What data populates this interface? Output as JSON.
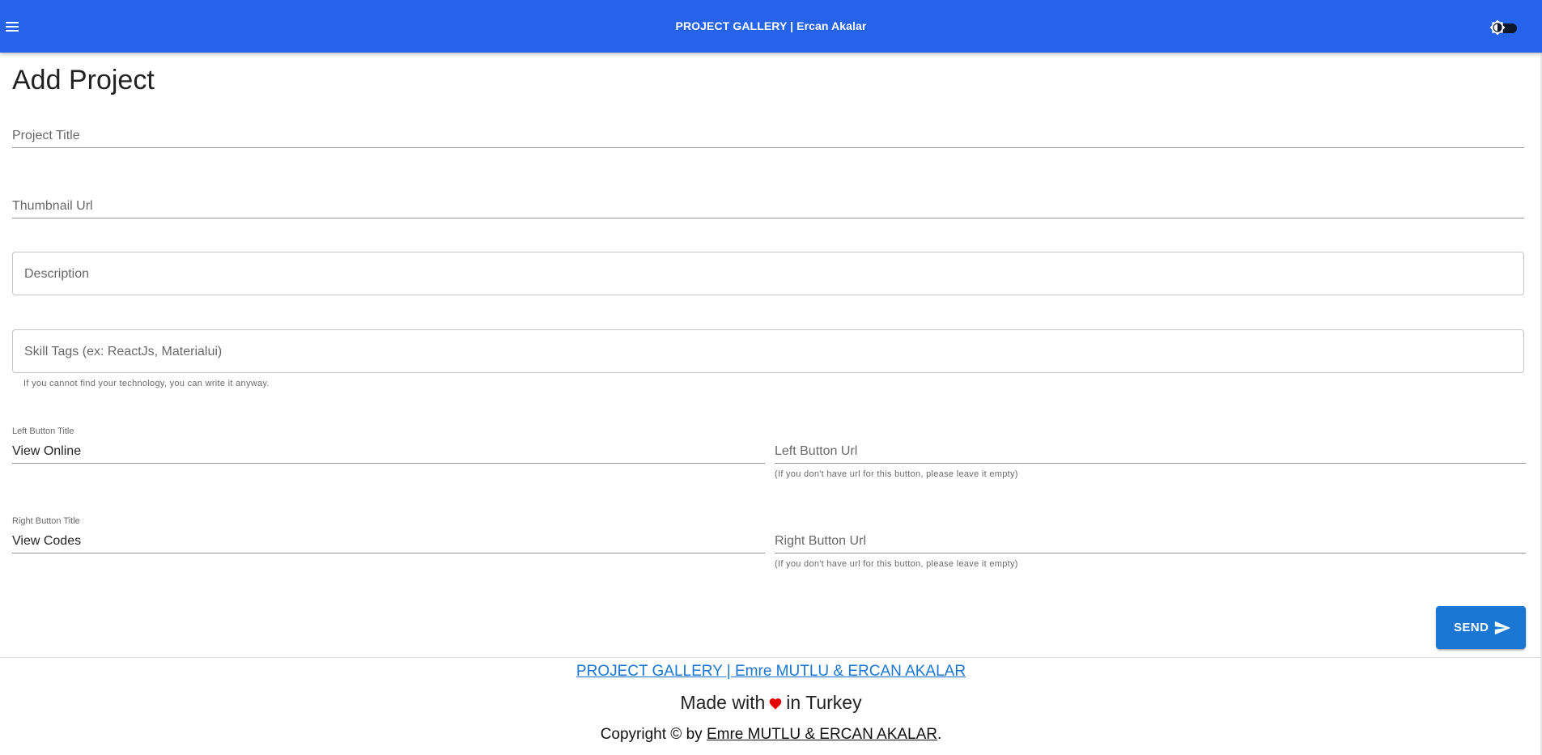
{
  "appbar": {
    "title": "PROJECT GALLERY  | Ercan Akalar",
    "menu_icon": "hamburger-menu-icon",
    "theme_icon": "brightness-icon",
    "color": "#2563eb"
  },
  "form": {
    "heading": "Add Project",
    "project_title": {
      "placeholder": "Project Title",
      "value": ""
    },
    "thumbnail_url": {
      "placeholder": "Thumbnail Url",
      "value": ""
    },
    "description": {
      "placeholder": "Description",
      "value": ""
    },
    "skill_tags": {
      "placeholder": "Skill Tags (ex: ReactJs, Materialui)",
      "helper": "If you cannot find your technology, you can write it anyway."
    },
    "left_button_title": {
      "label": "Left Button Title",
      "value": "View Online"
    },
    "left_button_url": {
      "placeholder": "Left Button Url",
      "helper": "(If you don't have url for this button, please leave it empty)"
    },
    "right_button_title": {
      "label": "Right Button Title",
      "value": "View Codes"
    },
    "right_button_url": {
      "placeholder": "Right Button Url",
      "helper": "(If you don't have url for this button, please leave it empty)"
    },
    "send_label": "SEND",
    "send_icon": "send-icon",
    "send_color": "#1976d2"
  },
  "footer": {
    "link_text": "PROJECT GALLERY | Emre MUTLU & ERCAN AKALAR",
    "made_prefix": "Made with",
    "made_suffix": "in Turkey",
    "heart_icon": "heart-icon",
    "heart_color": "#e60000",
    "copyright_prefix": "Copyright © by",
    "copyright_link": "Emre MUTLU & ERCAN AKALAR",
    "copyright_suffix": "."
  }
}
